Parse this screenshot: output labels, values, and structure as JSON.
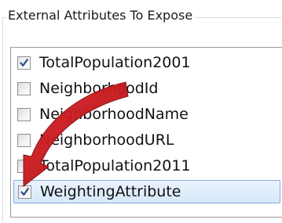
{
  "group": {
    "title": "External Attributes To Expose"
  },
  "attributes": [
    {
      "label": "TotalPopulation2001",
      "checked": true,
      "selected": false
    },
    {
      "label": "NeighborhoodId",
      "checked": false,
      "selected": false
    },
    {
      "label": "NeighborhoodName",
      "checked": false,
      "selected": false
    },
    {
      "label": "NeighborhoodURL",
      "checked": false,
      "selected": false
    },
    {
      "label": "TotalPopulation2011",
      "checked": false,
      "selected": false
    },
    {
      "label": "WeightingAttribute",
      "checked": true,
      "selected": true
    }
  ],
  "annotation": {
    "icon": "curved-arrow-icon",
    "color": "#c8181a"
  }
}
